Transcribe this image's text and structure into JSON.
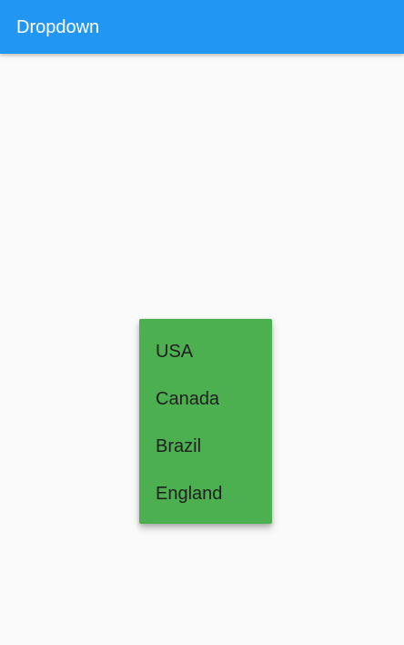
{
  "app": {
    "title": "Dropdown",
    "accent_color": "#2196f3"
  },
  "dropdown": {
    "background_color": "#4caf50",
    "items": [
      {
        "label": "USA"
      },
      {
        "label": "Canada"
      },
      {
        "label": "Brazil"
      },
      {
        "label": "England"
      }
    ]
  }
}
